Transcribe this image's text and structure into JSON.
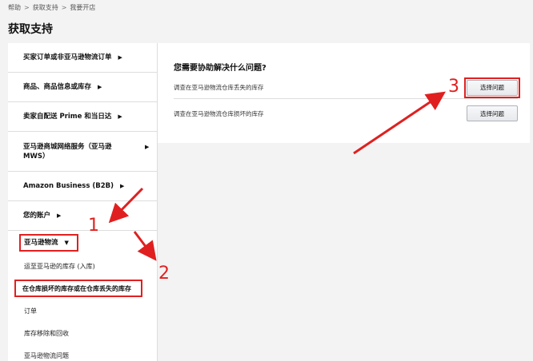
{
  "breadcrumb": {
    "items": [
      "帮助",
      "获取支持",
      "我要开店"
    ],
    "separator": ">"
  },
  "page_title": "获取支持",
  "sidebar": {
    "items": [
      {
        "label": "买家订单或非亚马逊物流订单"
      },
      {
        "label": "商品、商品信息或库存"
      },
      {
        "label": "卖家自配送 Prime 和当日达"
      },
      {
        "label": "亚马逊商城网络服务（亚马逊 MWS）"
      },
      {
        "label": "Amazon Business (B2B)"
      },
      {
        "label": "您的账户"
      }
    ],
    "active": {
      "label": "亚马逊物流",
      "subitems": [
        "运至亚马逊的库存 (入库)",
        "在仓库损坏的库存或在仓库丢失的库存",
        "订单",
        "库存移除和回收",
        "亚马逊物流问题"
      ]
    }
  },
  "main": {
    "heading": "您需要协助解决什么问题?",
    "rows": [
      {
        "text": "调查在亚马逊物流仓库丢失的库存",
        "button": "选择问题"
      },
      {
        "text": "调查在亚马逊物流仓库损坏的库存",
        "button": "选择问题"
      }
    ]
  },
  "annotations": {
    "labels": [
      "1",
      "2",
      "3"
    ],
    "color": "#e02020"
  },
  "icons": {
    "caret_right": "▶",
    "caret_down": "▼"
  }
}
